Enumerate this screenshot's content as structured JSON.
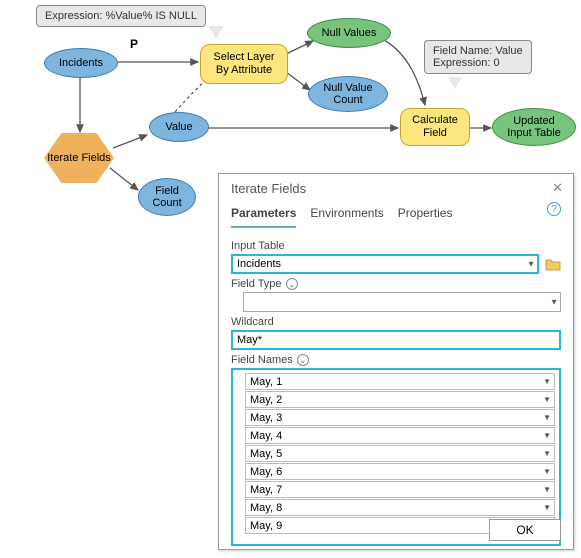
{
  "callouts": {
    "expr": "Expression: %Value% IS NULL",
    "calc": "Field Name: Value\nExpression: 0"
  },
  "p_label": "P",
  "nodes": {
    "incidents": "Incidents",
    "iterate_fields": "Iterate Fields",
    "value": "Value",
    "field_count": "Field\nCount",
    "select_layer": "Select Layer\nBy Attribute",
    "null_values": "Null Values",
    "null_value_count": "Null Value\nCount",
    "calculate_field": "Calculate\nField",
    "updated_input_table": "Updated\nInput Table"
  },
  "dialog": {
    "title": "Iterate Fields",
    "close_glyph": "✕",
    "tabs": {
      "parameters": "Parameters",
      "environments": "Environments",
      "properties": "Properties"
    },
    "help_glyph": "?",
    "labels": {
      "input_table": "Input Table",
      "field_type": "Field Type",
      "wildcard": "Wildcard",
      "field_names": "Field Names"
    },
    "input_table_value": "Incidents",
    "field_type_value": "",
    "wildcard_value": "May*",
    "field_names": [
      "May, 1",
      "May, 2",
      "May, 3",
      "May, 4",
      "May, 5",
      "May, 6",
      "May, 7",
      "May, 8",
      "May, 9"
    ],
    "ok": "OK"
  }
}
